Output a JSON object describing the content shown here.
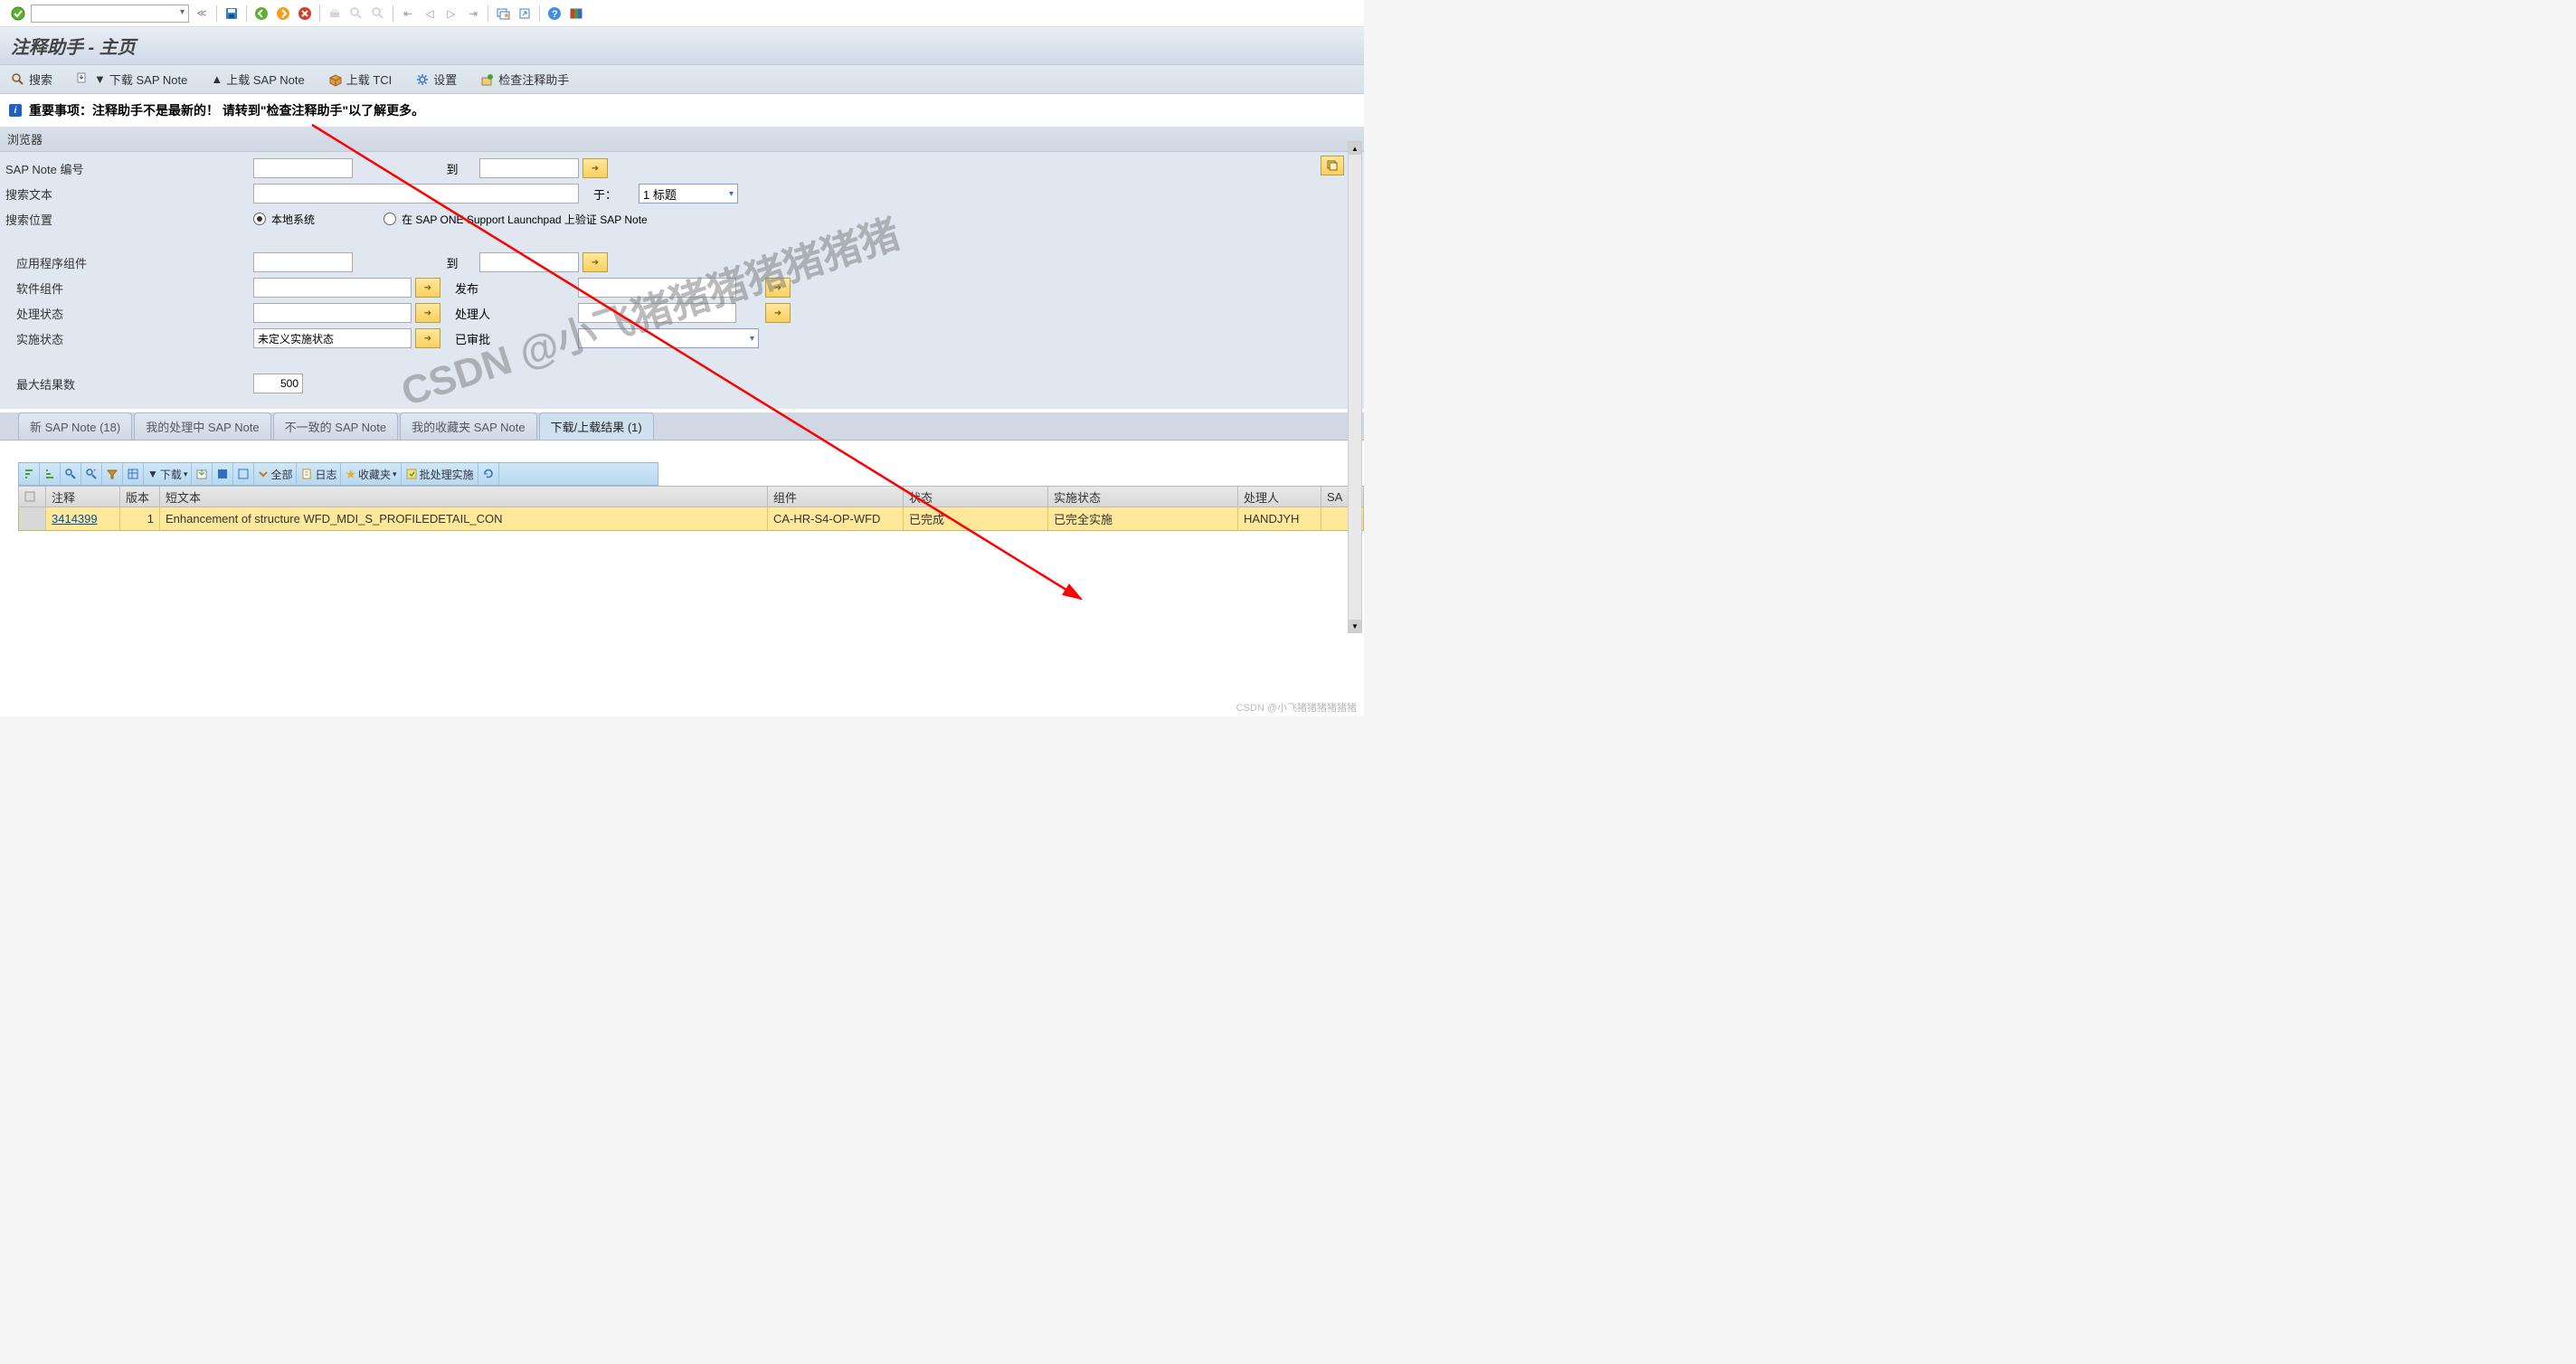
{
  "title": "注释助手 - 主页",
  "toolbar_icons": {
    "check": "✓",
    "save": "💾",
    "back": "↩",
    "exit": "↪",
    "cancel": "✖"
  },
  "actions": {
    "search": "搜索",
    "download_note": "下载 SAP Note",
    "upload_note": "上载 SAP Note",
    "upload_tci": "上载 TCI",
    "settings": "设置",
    "check_assistant": "检查注释助手"
  },
  "info_message": "重要事项：注释助手不是最新的！ 请转到\"检查注释助手\"以了解更多。",
  "browser": {
    "header": "浏览器",
    "sap_note_no": "SAP Note 编号",
    "to": "到",
    "search_text": "搜索文本",
    "in_label": "于：",
    "in_value": "1 标题",
    "search_loc": "搜索位置",
    "radio_local": "本地系统",
    "radio_remote": "在 SAP ONE Support Launchpad 上验证 SAP Note",
    "app_comp": "应用程序组件",
    "sw_comp": "软件组件",
    "release": "发布",
    "proc_status": "处理状态",
    "processor": "处理人",
    "impl_status_lbl": "实施状态",
    "impl_status_val": "未定义实施状态",
    "approved": "已审批",
    "max_results_lbl": "最大结果数",
    "max_results_val": "500"
  },
  "tabs": {
    "t1": "新 SAP Note (18)",
    "t2": "我的处理中 SAP Note",
    "t3": "不一致的 SAP Note",
    "t4": "我的收藏夹 SAP Note",
    "t5": "下载/上载结果 (1)"
  },
  "grid_toolbar": {
    "download": "下载",
    "all": "全部",
    "log": "日志",
    "fav": "收藏夹",
    "batch": "批处理实施"
  },
  "grid": {
    "headers": {
      "note": "注释",
      "version": "版本",
      "short": "短文本",
      "component": "组件",
      "status": "状态",
      "impl_status": "实施状态",
      "processor": "处理人",
      "sa": "SA"
    },
    "rows": [
      {
        "note": "3414399",
        "version": "1",
        "short": "Enhancement of structure WFD_MDI_S_PROFILEDETAIL_CON",
        "component": "CA-HR-S4-OP-WFD",
        "status": "已完成",
        "impl_status": "已完全实施",
        "processor": "HANDJYH"
      }
    ]
  },
  "watermark": "CSDN @小飞猪猪猪猪猪猪猪",
  "watermark_br": "CSDN @小飞猪猪猪猪猪猪"
}
